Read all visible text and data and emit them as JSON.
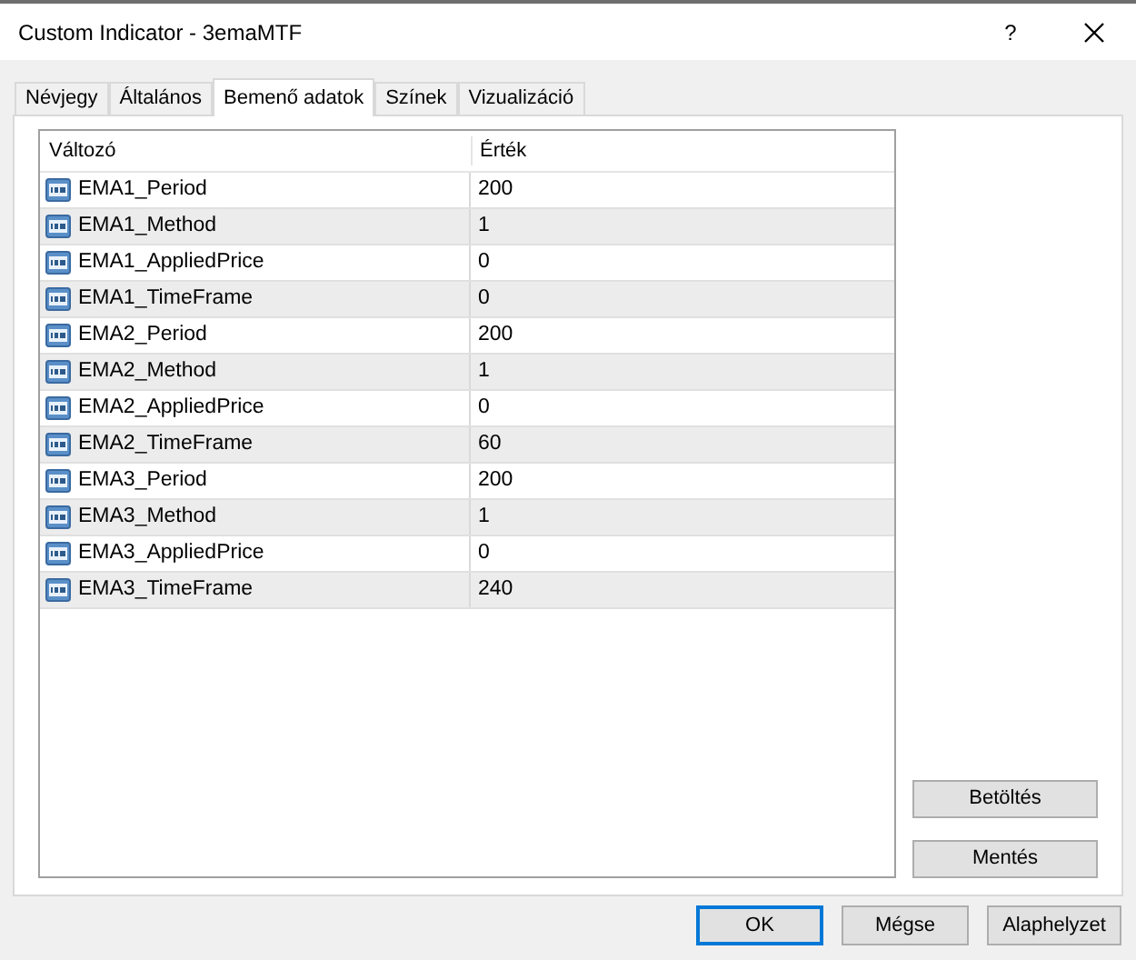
{
  "window": {
    "title": "Custom Indicator - 3emaMTF",
    "help": "?"
  },
  "tabs": [
    {
      "label": "Névjegy",
      "selected": false
    },
    {
      "label": "Általános",
      "selected": false
    },
    {
      "label": "Bemenő adatok",
      "selected": true
    },
    {
      "label": "Színek",
      "selected": false
    },
    {
      "label": "Vizualizáció",
      "selected": false
    }
  ],
  "table": {
    "columns": [
      "Változó",
      "Érték"
    ],
    "rows": [
      {
        "name": "EMA1_Period",
        "value": "200"
      },
      {
        "name": "EMA1_Method",
        "value": "1"
      },
      {
        "name": "EMA1_AppliedPrice",
        "value": "0"
      },
      {
        "name": "EMA1_TimeFrame",
        "value": "0"
      },
      {
        "name": "EMA2_Period",
        "value": "200"
      },
      {
        "name": "EMA2_Method",
        "value": "1"
      },
      {
        "name": "EMA2_AppliedPrice",
        "value": "0"
      },
      {
        "name": "EMA2_TimeFrame",
        "value": "60"
      },
      {
        "name": "EMA3_Period",
        "value": "200"
      },
      {
        "name": "EMA3_Method",
        "value": "1"
      },
      {
        "name": "EMA3_AppliedPrice",
        "value": "0"
      },
      {
        "name": "EMA3_TimeFrame",
        "value": "240"
      }
    ]
  },
  "side_buttons": [
    "Betöltés",
    "Mentés"
  ],
  "footer_buttons": [
    {
      "label": "OK",
      "default": true
    },
    {
      "label": "Mégse",
      "default": false
    },
    {
      "label": "Alaphelyzet",
      "default": false
    }
  ]
}
